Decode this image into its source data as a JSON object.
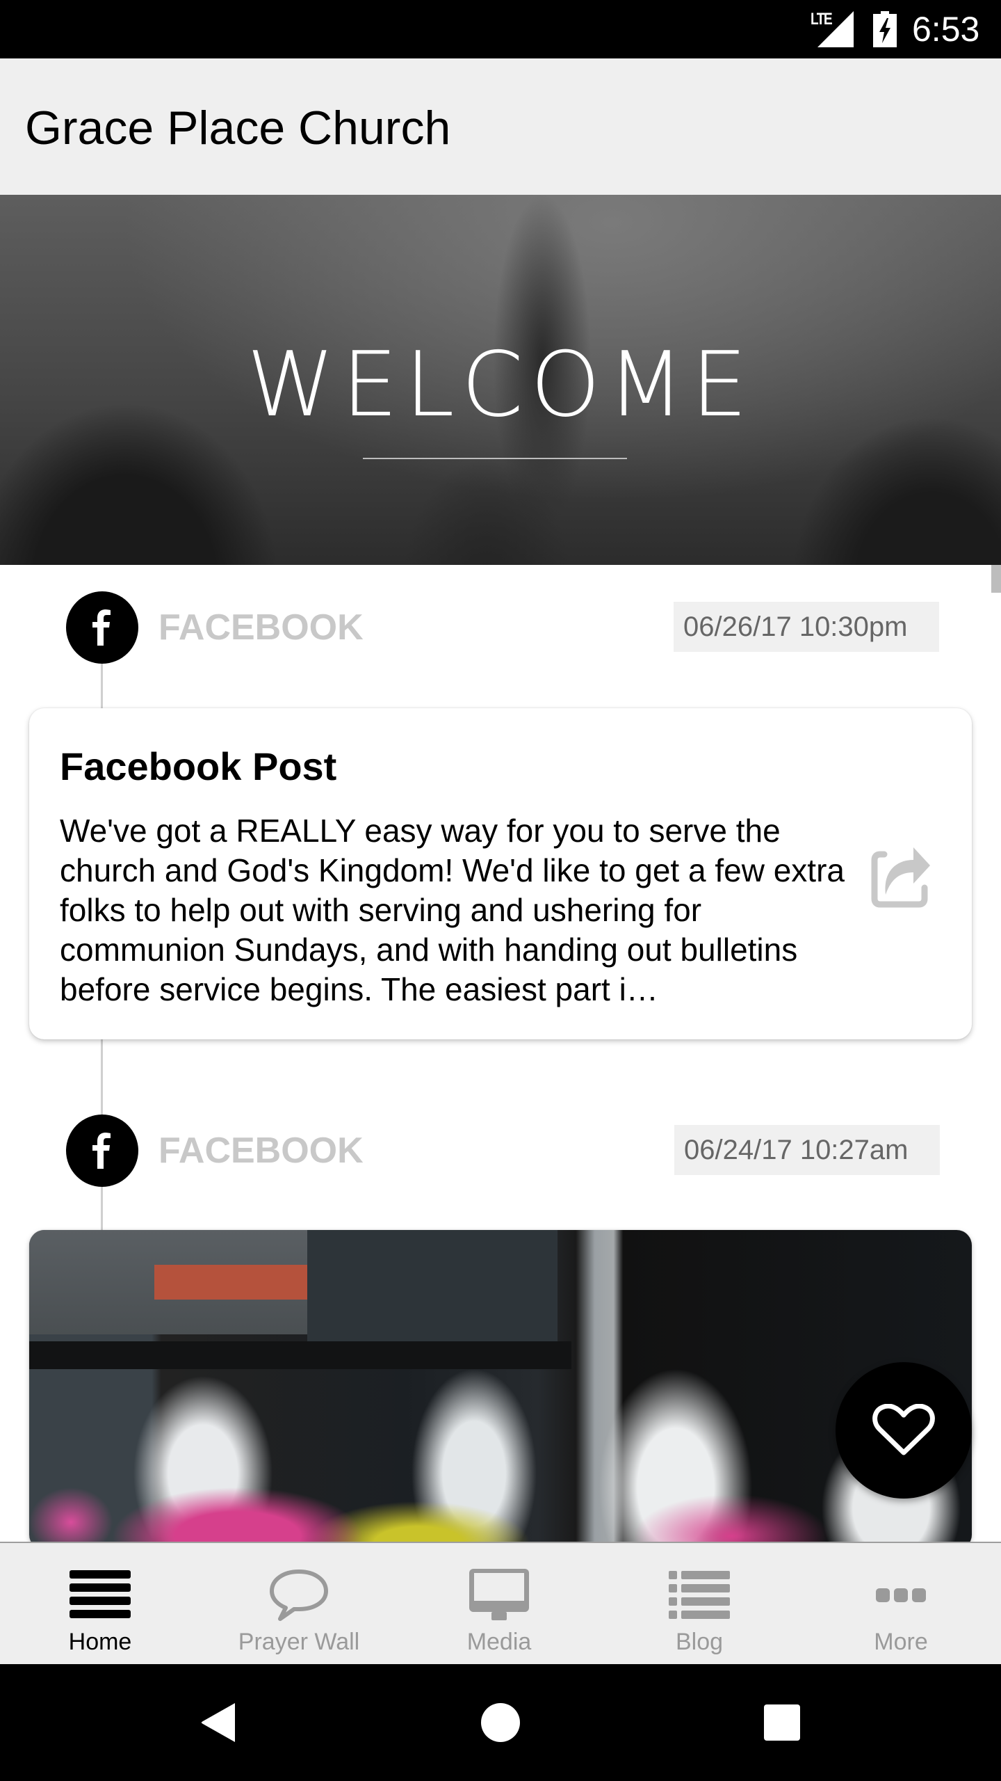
{
  "status_bar": {
    "network": "LTE",
    "time": "6:53",
    "icons": [
      "lte-signal-icon",
      "battery-charging-icon"
    ]
  },
  "app_bar": {
    "title": "Grace Place Church"
  },
  "hero": {
    "heading": "WELCOME"
  },
  "feed": [
    {
      "source_icon": "facebook-icon",
      "source": "FACEBOOK",
      "timestamp": "06/26/17 10:30pm",
      "title": "Facebook Post",
      "body": "We've got a REALLY easy way for you to serve the church and God's Kingdom! We'd like to get a few extra folks to help out with serving and ushering for communion Sundays, and with handing out bulletins before service begins. The easiest part i…",
      "action_icon": "share-icon"
    },
    {
      "source_icon": "facebook-icon",
      "source": "FACEBOOK",
      "timestamp": "06/24/17 10:27am",
      "media": "photo"
    }
  ],
  "fab": {
    "icon": "heart-icon"
  },
  "bottom_nav": {
    "active": "Home",
    "items": [
      {
        "label": "Home",
        "icon": "menu-lines-icon"
      },
      {
        "label": "Prayer Wall",
        "icon": "speech-bubble-icon"
      },
      {
        "label": "Media",
        "icon": "monitor-icon"
      },
      {
        "label": "Blog",
        "icon": "list-icon"
      },
      {
        "label": "More",
        "icon": "more-dots-icon"
      }
    ]
  },
  "system_nav": {
    "buttons": [
      "back",
      "home",
      "recents"
    ]
  },
  "colors": {
    "active_nav": "#000000",
    "inactive_nav": "#9a9a9a",
    "source_label": "#c8c8c8",
    "timestamp_text": "#666666",
    "timestamp_bg": "#f0f0f0",
    "app_bar_bg": "#efefef"
  }
}
